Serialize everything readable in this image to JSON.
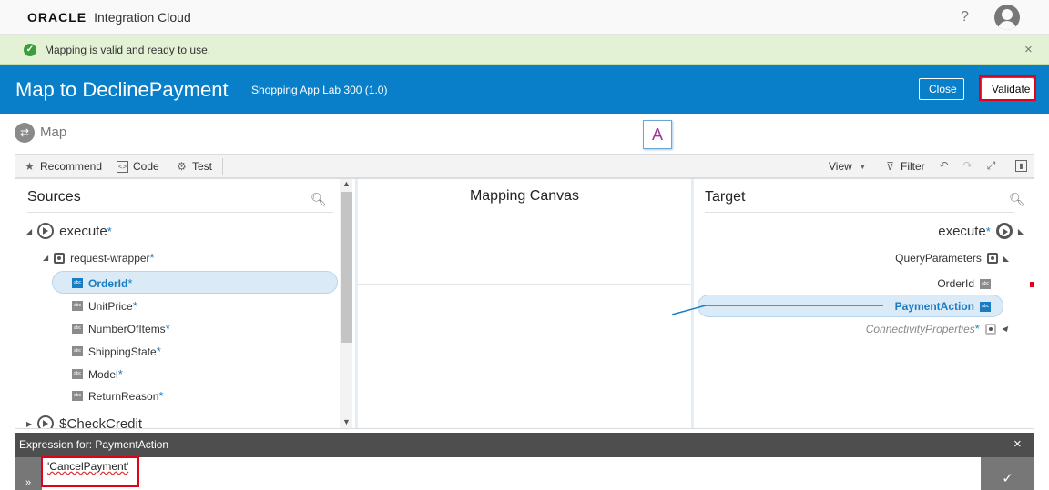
{
  "app": {
    "brand_logo": "ORACLE",
    "product": "Integration Cloud",
    "help_label": "?"
  },
  "message": {
    "text": "Mapping is valid and ready to use.",
    "close_label": "×"
  },
  "header": {
    "title": "Map to DeclinePayment",
    "subtitle": "Shopping App Lab 300 (1.0)",
    "close_label": "Close",
    "validate_label": "Validate"
  },
  "section": {
    "label": "Map"
  },
  "toolbar": {
    "recommend_label": "Recommend",
    "code_label": "Code",
    "test_label": "Test",
    "view_label": "View",
    "filter_label": "Filter"
  },
  "sources": {
    "title": "Sources",
    "root": {
      "label": "execute",
      "required": "*"
    },
    "wrapper": {
      "label": "request-wrapper",
      "required": "*"
    },
    "fields": [
      {
        "label": "OrderId",
        "required": "*",
        "type_icon": "abc",
        "selected": true
      },
      {
        "label": "UnitPrice",
        "required": "*",
        "type_icon": "abc"
      },
      {
        "label": "NumberOfItems",
        "required": "*",
        "type_icon": "abc"
      },
      {
        "label": "ShippingState",
        "required": "*",
        "type_icon": "abc"
      },
      {
        "label": "Model",
        "required": "*",
        "type_icon": "abc"
      },
      {
        "label": "ReturnReason",
        "required": "*",
        "type_icon": "abc"
      }
    ],
    "next_root": {
      "label": "$CheckCredit"
    }
  },
  "canvas": {
    "title": "Mapping Canvas",
    "function_label": "A"
  },
  "target": {
    "title": "Target",
    "root": {
      "label": "execute",
      "required": "*"
    },
    "query": {
      "label": "QueryParameters"
    },
    "order": {
      "label": "OrderId",
      "type_icon": "abc"
    },
    "payment": {
      "label": "PaymentAction",
      "type_icon": "abc",
      "selected": true
    },
    "connectivity": {
      "label": "ConnectivityProperties",
      "required": "*"
    }
  },
  "expression": {
    "prefix": "Expression for: ",
    "target": "PaymentAction",
    "value": "'CancelPayment'",
    "close_label": "×",
    "ok_label": "✓",
    "expand_label": "»"
  },
  "colors": {
    "header_blue": "#0a7fc9",
    "success_bg": "#e3f1d4",
    "selection_bg": "#dbeaf7",
    "highlight_red": "#e3001b"
  }
}
